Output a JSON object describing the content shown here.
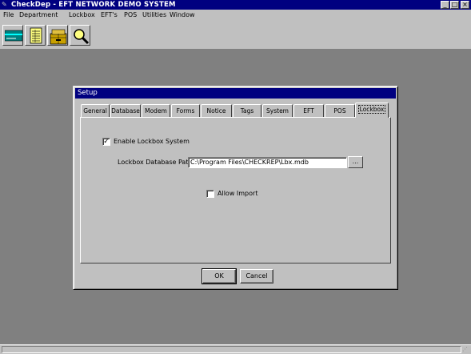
{
  "app": {
    "title": "CheckDep - EFT NETWORK DEMO SYSTEM",
    "icon_glyph": "✎",
    "caption_buttons": {
      "minimize": "_",
      "maximize": "□",
      "close": "×"
    }
  },
  "menu": {
    "items": [
      "File",
      "Department",
      "Lockbox",
      "EFT's",
      "POS",
      "Utilities",
      "Window"
    ]
  },
  "toolbar": {
    "buttons": [
      "card-icon",
      "ledger-icon",
      "cash-drawer-icon",
      "search-icon"
    ]
  },
  "dialog": {
    "title": "Setup",
    "tabs": [
      "General",
      "Database",
      "Modem",
      "Forms",
      "Notice",
      "Tags",
      "System",
      "EFT",
      "POS",
      "Lockbox"
    ],
    "active_tab": "Lockbox",
    "enable_lockbox": {
      "label": "Enable Lockbox System",
      "checked": true,
      "mark": "✓"
    },
    "db_path": {
      "label": "Lockbox Database Path",
      "value": "C:\\Program Files\\CHECKREP\\Lbx.mdb",
      "browse_label": "..."
    },
    "allow_import": {
      "label": "Allow Import",
      "checked": false
    },
    "ok_label": "OK",
    "cancel_label": "Cancel"
  },
  "colors": {
    "titlebar": "#000080",
    "face": "#c0c0c0",
    "workspace": "#808080"
  }
}
